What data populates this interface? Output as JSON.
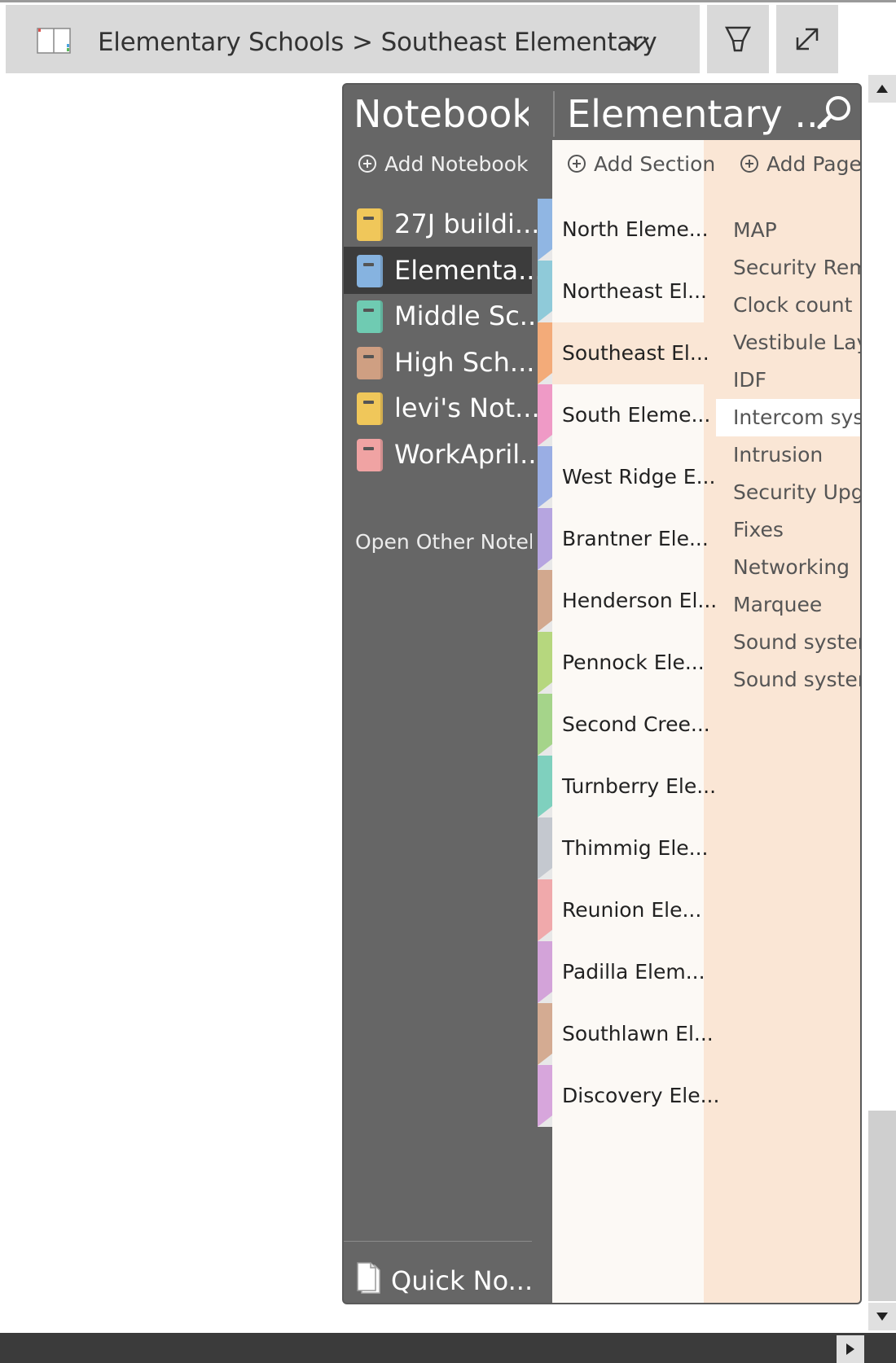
{
  "titlebar": {
    "breadcrumb_notebook": "Elementary Schools",
    "breadcrumb_separator": ">",
    "breadcrumb_section": "Southeast Elementary"
  },
  "panel": {
    "notebooks_heading": "Notebooks",
    "sections_heading": "Elementary ...",
    "add_notebook": "Add Notebook",
    "add_section": "Add Section",
    "add_page": "Add Page",
    "open_other": "Open Other Notebooks",
    "quick_notes": "Quick No...",
    "notebooks": [
      {
        "label": "27J buildi...",
        "color": "#f0c75a",
        "selected": false
      },
      {
        "label": "Elementa...",
        "color": "#86b3e0",
        "selected": true
      },
      {
        "label": "Middle Sc...",
        "color": "#6fcbb2",
        "selected": false
      },
      {
        "label": "High Sch...",
        "color": "#cf9f82",
        "selected": false
      },
      {
        "label": "levi's Not...",
        "color": "#f0c75a",
        "selected": false
      },
      {
        "label": "WorkApril...",
        "color": "#f0a3a3",
        "selected": false
      }
    ],
    "sections": [
      {
        "label": "North Eleme...",
        "color": "#90b6e3",
        "selected": false
      },
      {
        "label": "Northeast El...",
        "color": "#8fcad9",
        "selected": false
      },
      {
        "label": "Southeast El...",
        "color": "#f3ab79",
        "selected": true
      },
      {
        "label": "South Eleme...",
        "color": "#ef9ac6",
        "selected": false
      },
      {
        "label": "West Ridge E...",
        "color": "#9aaee4",
        "selected": false
      },
      {
        "label": "Brantner Ele...",
        "color": "#b6a5e0",
        "selected": false
      },
      {
        "label": "Henderson El...",
        "color": "#d2a88e",
        "selected": false
      },
      {
        "label": "Pennock Ele...",
        "color": "#b6d77e",
        "selected": false
      },
      {
        "label": "Second Cree...",
        "color": "#a5d48a",
        "selected": false
      },
      {
        "label": "Turnberry Ele...",
        "color": "#7fd0be",
        "selected": false
      },
      {
        "label": "Thimmig Ele...",
        "color": "#c4c8cf",
        "selected": false
      },
      {
        "label": "Reunion Ele...",
        "color": "#f0a9ab",
        "selected": false
      },
      {
        "label": "Padilla Elem...",
        "color": "#d3a3d9",
        "selected": false
      },
      {
        "label": "Southlawn El...",
        "color": "#d4ab92",
        "selected": false
      },
      {
        "label": "Discovery Ele...",
        "color": "#d7a6dc",
        "selected": false
      }
    ],
    "pages": [
      {
        "label": "MAP",
        "selected": false
      },
      {
        "label": "Security Remote",
        "selected": false
      },
      {
        "label": "Clock count",
        "selected": false
      },
      {
        "label": "Vestibule Layout",
        "selected": false
      },
      {
        "label": "IDF",
        "selected": false
      },
      {
        "label": "Intercom system",
        "selected": true
      },
      {
        "label": "Intrusion",
        "selected": false
      },
      {
        "label": "Security Upgrade",
        "selected": false
      },
      {
        "label": "Fixes",
        "selected": false
      },
      {
        "label": "Networking",
        "selected": false
      },
      {
        "label": "Marquee",
        "selected": false
      },
      {
        "label": "Sound system",
        "selected": false
      },
      {
        "label": "Sound system",
        "selected": false
      }
    ]
  },
  "icons": {
    "notebook_title_icon": "open-book-icon",
    "dropdown": "chevron-down-icon",
    "pen": "pen-icon",
    "expand": "expand-icon",
    "search": "search-icon"
  }
}
